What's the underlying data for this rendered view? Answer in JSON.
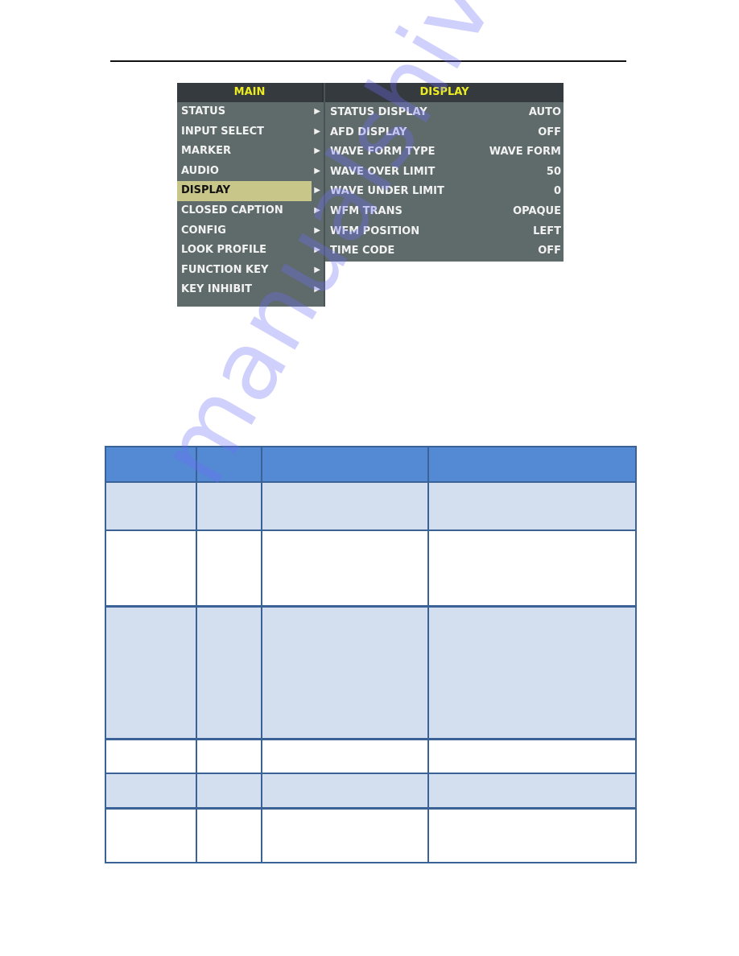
{
  "main_menu": {
    "title": "MAIN",
    "items": [
      {
        "label": "STATUS",
        "arrow": "▶"
      },
      {
        "label": "INPUT SELECT",
        "arrow": "▶"
      },
      {
        "label": "MARKER",
        "arrow": "▶"
      },
      {
        "label": "AUDIO",
        "arrow": "▶"
      },
      {
        "label": "DISPLAY",
        "arrow": "▶",
        "selected": true
      },
      {
        "label": "CLOSED CAPTION",
        "arrow": "▶"
      },
      {
        "label": "CONFIG",
        "arrow": "▶"
      },
      {
        "label": "LOOK PROFILE",
        "arrow": "▶"
      },
      {
        "label": "FUNCTION KEY",
        "arrow": "▶"
      },
      {
        "label": "KEY INHIBIT",
        "arrow": "▶"
      }
    ]
  },
  "display_menu": {
    "title": "DISPLAY",
    "items": [
      {
        "label": "STATUS DISPLAY",
        "value": "AUTO"
      },
      {
        "label": "AFD DISPLAY",
        "value": "OFF"
      },
      {
        "label": "WAVE FORM TYPE",
        "value": "WAVE FORM"
      },
      {
        "label": "WAVE OVER LIMIT",
        "value": "50"
      },
      {
        "label": "WAVE UNDER LIMIT",
        "value": "0"
      },
      {
        "label": "WFM TRANS",
        "value": "OPAQUE"
      },
      {
        "label": "WFM POSITION",
        "value": "LEFT"
      },
      {
        "label": "TIME CODE",
        "value": "OFF"
      }
    ]
  },
  "table": {
    "headers": [
      "",
      "",
      "",
      ""
    ],
    "rows": [
      [
        "",
        "",
        "",
        ""
      ],
      [
        "",
        "",
        "",
        ""
      ],
      [
        "",
        "",
        "",
        ""
      ],
      [
        "",
        "",
        "",
        ""
      ],
      [
        "",
        "",
        "",
        ""
      ],
      [
        "",
        "",
        "",
        ""
      ]
    ]
  },
  "watermark": "manualshive.com",
  "colors": {
    "menu_bg": "#5f6a6a",
    "menu_header_bg": "#353a3f",
    "menu_title": "#ecec22",
    "selected_bg": "#c9c68a",
    "table_header": "#548ad3",
    "table_band": "#d3dfee",
    "table_border": "#3b6296"
  }
}
